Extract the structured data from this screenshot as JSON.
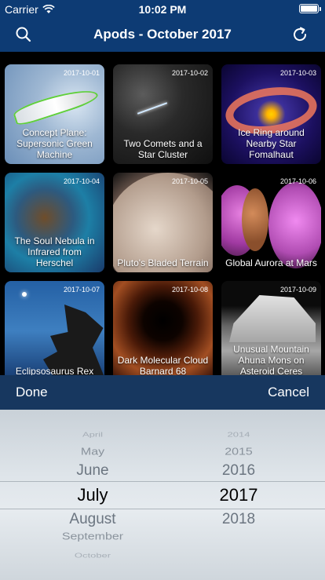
{
  "status_bar": {
    "carrier": "Carrier",
    "time": "10:02 PM"
  },
  "nav": {
    "title": "Apods - October 2017",
    "left_icon": "search-icon",
    "right_icon": "refresh-icon"
  },
  "grid": {
    "items": [
      {
        "date": "2017-10-01",
        "title": "Concept Plane: Supersonic Green Machine"
      },
      {
        "date": "2017-10-02",
        "title": "Two Comets and a Star Cluster"
      },
      {
        "date": "2017-10-03",
        "title": "Ice Ring around Nearby Star Fomalhaut"
      },
      {
        "date": "2017-10-04",
        "title": "The Soul Nebula in Infrared from Herschel"
      },
      {
        "date": "2017-10-05",
        "title": "Pluto's Bladed Terrain"
      },
      {
        "date": "2017-10-06",
        "title": "Global Aurora at Mars"
      },
      {
        "date": "2017-10-07",
        "title": "Eclipsosaurus Rex"
      },
      {
        "date": "2017-10-08",
        "title": "Dark Molecular Cloud Barnard 68"
      },
      {
        "date": "2017-10-09",
        "title": "Unusual Mountain Ahuna Mons on Asteroid Ceres"
      }
    ]
  },
  "toolbar": {
    "done_label": "Done",
    "cancel_label": "Cancel"
  },
  "picker": {
    "months": [
      "April",
      "May",
      "June",
      "July",
      "August",
      "September",
      "October"
    ],
    "selected_month": "July",
    "years": [
      "2014",
      "2015",
      "2016",
      "2017",
      "2018"
    ],
    "selected_year": "2017"
  }
}
